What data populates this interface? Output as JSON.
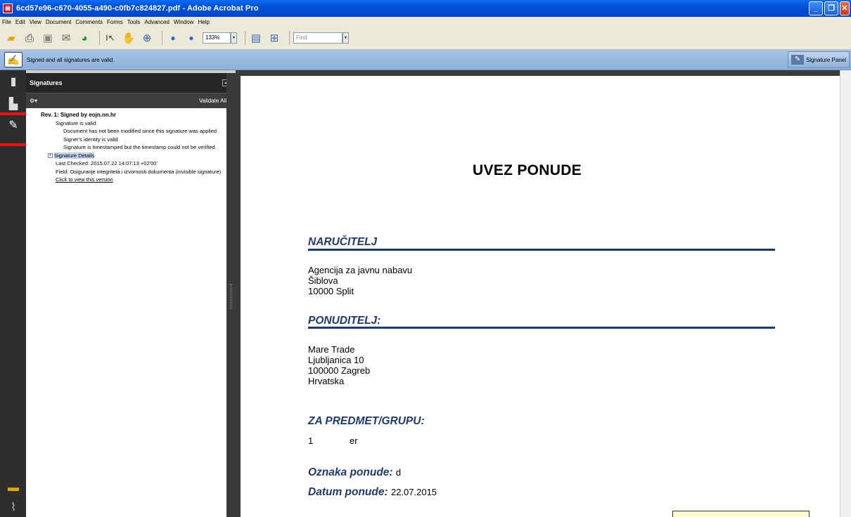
{
  "window": {
    "title": "6cd57e96-c670-4055-a490-c0fb7c824827.pdf - Adobe Acrobat Pro",
    "controls": [
      "minimize",
      "maximize",
      "close"
    ]
  },
  "menu": [
    "File",
    "Edit",
    "View",
    "Document",
    "Comments",
    "Forms",
    "Tools",
    "Advanced",
    "Window",
    "Help"
  ],
  "toolbar": {
    "zoom_value": "133%",
    "find_placeholder": "Find"
  },
  "message_bar": {
    "text": "Signed and all signatures are valid.",
    "signature_panel_label": "Signature Panel"
  },
  "signatures_panel": {
    "title": "Signatures",
    "validate_all": "Validate All",
    "revision": "Rev. 1: Signed by eojn.nn.hr",
    "status": "Signature is valid:",
    "details": [
      "Document has not been modified since this signature was applied",
      "Signer's identity is valid",
      "Signature is timestamped but the timestamp could not be verified."
    ],
    "signature_details": "Signature Details",
    "last_checked": "Last Checked: 2015.07.22 14:07:13 +02'00'",
    "field": "Field: Osiguranje integriteta i izvornosti dokumenta (invisible signature)",
    "view_version": "Click to view this version"
  },
  "document": {
    "title": "UVEZ PONUDE",
    "narucitelj": {
      "heading": "NARUČITELJ",
      "lines": [
        "Agencija za javnu nabavu",
        "Šiblova",
        "10000 Split"
      ]
    },
    "ponuditelj": {
      "heading": "PONUDITELJ:",
      "lines": [
        "Mare Trade",
        "Ljubljanica 10",
        "100000 Zagreb",
        "Hrvatska"
      ]
    },
    "predmet": {
      "heading": "ZA PREDMET/GRUPU:",
      "number": "1",
      "name": "er"
    },
    "oznaka_label": "Oznaka ponude:",
    "oznaka_value": "d",
    "datum_label": "Datum ponude:",
    "datum_value": "22.07.2015"
  },
  "colors": {
    "heading_blue": "#1c3a6e",
    "highlight_red": "#f01010"
  }
}
